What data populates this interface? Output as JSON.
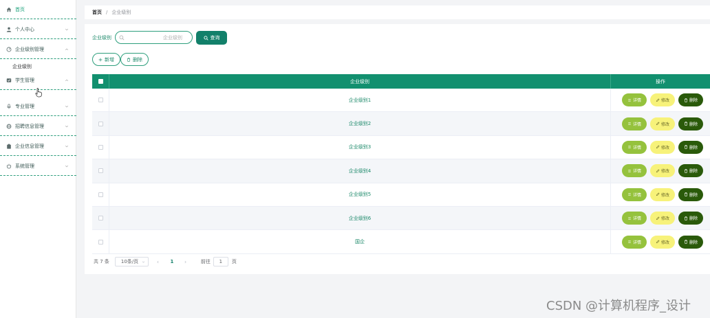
{
  "sidebar": {
    "items": [
      {
        "label": "首页",
        "icon": "home-icon",
        "expandable": false
      },
      {
        "label": "个人中心",
        "icon": "user-icon",
        "expandable": true
      },
      {
        "label": "企业级别管理",
        "icon": "gauge-icon",
        "expandable": true,
        "expanded": true
      },
      {
        "label": "学生管理",
        "icon": "checklist-icon",
        "expandable": true
      },
      {
        "label": "专业管理",
        "icon": "microphone-icon",
        "expandable": true
      },
      {
        "label": "招聘信息管理",
        "icon": "globe-icon",
        "expandable": true
      },
      {
        "label": "企业信息管理",
        "icon": "clipboard-icon",
        "expandable": true
      },
      {
        "label": "系统管理",
        "icon": "power-icon",
        "expandable": true
      }
    ],
    "submenu": {
      "label": "企业级别"
    }
  },
  "breadcrumb": {
    "home": "首页",
    "separator": "/",
    "current": "企业级别"
  },
  "search": {
    "label": "企业级别",
    "placeholder": "企业级别",
    "value": "",
    "button": "查询"
  },
  "actions": {
    "add": "新增",
    "delete": "删除"
  },
  "table": {
    "columns": {
      "name": "企业级别",
      "ops": "操作"
    },
    "rows": [
      {
        "name": "企业级别1"
      },
      {
        "name": "企业级别2"
      },
      {
        "name": "企业级别3"
      },
      {
        "name": "企业级别4"
      },
      {
        "name": "企业级别5"
      },
      {
        "name": "企业级别6"
      },
      {
        "name": "国企"
      }
    ],
    "ops": {
      "detail": "详情",
      "edit": "修改",
      "delete": "删除"
    }
  },
  "pagination": {
    "total": "共 7 条",
    "page_size": "10条/页",
    "current_page": "1",
    "goto_label": "前往",
    "goto_value": "1",
    "goto_unit": "页"
  },
  "watermark": "CSDN @计算机程序_设计",
  "colors": {
    "primary": "#12806a",
    "header": "#12906f",
    "detail": "#95c23d",
    "edit": "#f7f27a",
    "delete": "#2a5a0a",
    "border": "#2c9e7c"
  }
}
